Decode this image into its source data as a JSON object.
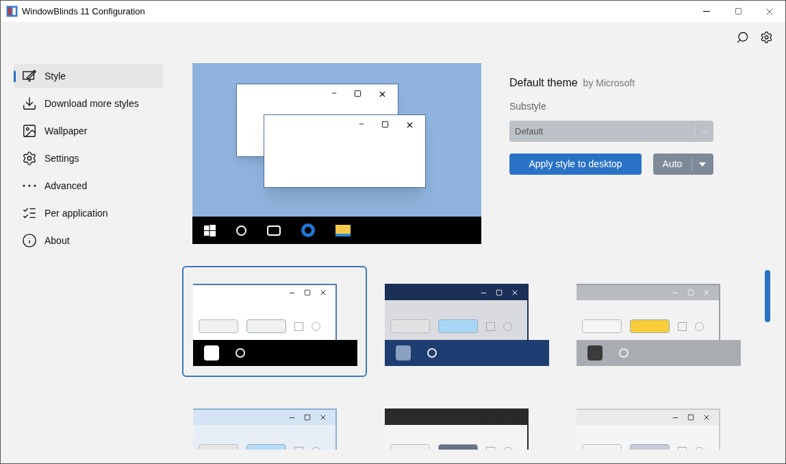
{
  "window": {
    "title": "WindowBlinds 11 Configuration"
  },
  "nav": [
    {
      "label": "Style",
      "selected": true
    },
    {
      "label": "Download more styles",
      "selected": false
    },
    {
      "label": "Wallpaper",
      "selected": false
    },
    {
      "label": "Settings",
      "selected": false
    },
    {
      "label": "Advanced",
      "selected": false
    },
    {
      "label": "Per application",
      "selected": false
    },
    {
      "label": "About",
      "selected": false
    }
  ],
  "theme": {
    "name": "Default theme",
    "author": "by Microsoft",
    "substyle_label": "Substyle",
    "substyle": {
      "value": "Default",
      "disabled": true
    },
    "apply_button": "Apply style to desktop",
    "mode_button": "Auto"
  },
  "styles": [
    {
      "kind": "flat",
      "selected": true
    },
    {
      "kind": "navy",
      "selected": false
    },
    {
      "kind": "silver",
      "selected": false
    },
    {
      "kind": "aero",
      "selected": false
    },
    {
      "kind": "dark",
      "selected": false
    },
    {
      "kind": "mono",
      "selected": false
    }
  ]
}
